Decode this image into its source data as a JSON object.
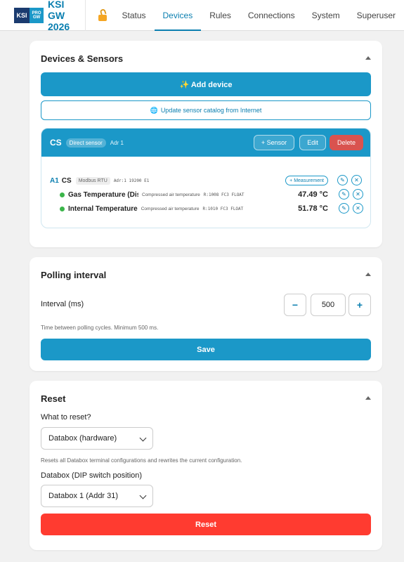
{
  "app": {
    "logo_left": "KSI",
    "logo_right_top": "PRO",
    "logo_right_bottom": "GW",
    "title": "KSI GW 2026",
    "lock_icon": "unlocked-padlock-icon"
  },
  "nav": {
    "tabs": [
      {
        "label": "Status"
      },
      {
        "label": "Devices",
        "active": true
      },
      {
        "label": "Rules"
      },
      {
        "label": "Connections"
      },
      {
        "label": "System"
      },
      {
        "label": "Superuser"
      }
    ]
  },
  "devices_card": {
    "title": "Devices & Sensors",
    "add_device_label": "✨ Add device",
    "update_catalog_icon": "globe-icon",
    "update_catalog_label": "Update sensor catalog from Internet",
    "device": {
      "name": "CS",
      "type_badge": "Direct sensor",
      "address": "Adr 1",
      "sensor_button": "+ Sensor",
      "edit_button": "Edit",
      "delete_button": "Delete",
      "sensor": {
        "index": "A1",
        "name": "CS",
        "protocol": "Modbus RTU",
        "params": "Adr:1 19200 E1",
        "measurement_button": "+ Measurement",
        "measurements": [
          {
            "name": "Gas Temperature (Dis",
            "description": "Compressed air temperature",
            "register": "R:1008 FC3 FLOAT",
            "value": "47.49 °C",
            "status": "online"
          },
          {
            "name": "Internal Temperature",
            "description": "Compressed air temperature",
            "register": "R:1010 FC3 FLOAT",
            "value": "51.78 °C",
            "status": "online"
          }
        ]
      }
    }
  },
  "polling_card": {
    "title": "Polling interval",
    "interval_label": "Interval (ms)",
    "minus": "−",
    "value": "500",
    "plus": "+",
    "hint": "Time between polling cycles. Minimum 500 ms.",
    "save_label": "Save"
  },
  "reset_card": {
    "title": "Reset",
    "what_label": "What to reset?",
    "what_value": "Databox (hardware)",
    "what_hint": "Resets all Databox terminal configurations and rewrites the current configuration.",
    "databox_label": "Databox (DIP switch position)",
    "databox_value": "Databox 1 (Addr 31)",
    "reset_label": "Reset"
  },
  "colors": {
    "primary": "#1b98c8",
    "accent_text": "#0b7fb0",
    "danger": "#ff3b30",
    "delete": "#d9534f",
    "status_online": "#3bb54a"
  }
}
